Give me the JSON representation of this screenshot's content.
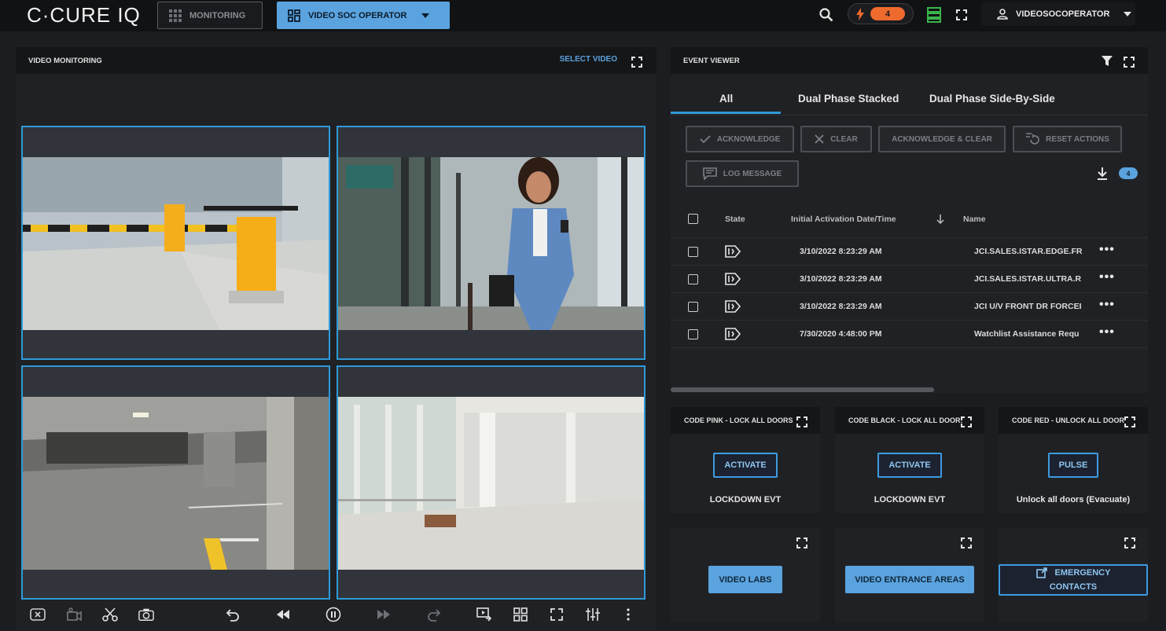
{
  "app": {
    "logo": "C·CURE IQ"
  },
  "topbar": {
    "monitoring_label": "MONITORING",
    "workspace_label": "VIDEO SOC OPERATOR",
    "alert_count": "4",
    "user_label": "VIDEOSOCOPERATOR",
    "accent": "#5aa3df",
    "alert_color": "#ef6a2d"
  },
  "video_monitoring": {
    "title": "VIDEO MONITORING",
    "select_video": "SELECT VIDEO",
    "tiles": [
      "parking-barrier-camera",
      "lobby-woman-camera",
      "parking-garage-camera",
      "atrium-camera"
    ],
    "toolbar_icons": [
      "clear-video-icon",
      "camera-off-icon",
      "scissors-icon",
      "snapshot-icon",
      "undo-icon",
      "rewind-icon",
      "pause-icon",
      "fast-forward-icon",
      "redo-icon",
      "export-icon",
      "grid-icon",
      "fullscreen-icon",
      "sliders-icon",
      "more-vertical-icon"
    ]
  },
  "event_viewer": {
    "title": "EVENT VIEWER",
    "tabs": [
      "All",
      "Dual Phase Stacked",
      "Dual Phase Side-By-Side"
    ],
    "buttons": {
      "acknowledge": "ACKNOWLEDGE",
      "clear": "CLEAR",
      "ack_clear": "ACKNOWLEDGE & CLEAR",
      "reset": "RESET ACTIONS",
      "log": "LOG MESSAGE"
    },
    "download_count": "4",
    "columns": {
      "state": "State",
      "date": "Initial Activation Date/Time",
      "name": "Name"
    },
    "rows": [
      {
        "date": "3/10/2022 8:23:29 AM",
        "name": "JCI.SALES.ISTAR.EDGE.FR"
      },
      {
        "date": "3/10/2022 8:23:29 AM",
        "name": "JCI.SALES.ISTAR.ULTRA.R"
      },
      {
        "date": "3/10/2022 8:23:29 AM",
        "name": "JCI U/V FRONT DR FORCEI"
      },
      {
        "date": "7/30/2020 4:48:00 PM",
        "name": "Watchlist Assistance Requ"
      }
    ]
  },
  "actions": [
    {
      "title": "CODE PINK - LOCK ALL DOORS",
      "button": "ACTIVATE",
      "desc": "LOCKDOWN EVT"
    },
    {
      "title": "CODE BLACK - LOCK ALL DOOR:",
      "button": "ACTIVATE",
      "desc": "LOCKDOWN EVT"
    },
    {
      "title": "CODE RED - UNLOCK ALL DOOR",
      "button": "PULSE",
      "desc": "Unlock all doors (Evacuate)"
    }
  ],
  "links": {
    "video_labs": "VIDEO LABS",
    "entrance": "VIDEO ENTRANCE AREAS",
    "emergency_line1": "EMERGENCY",
    "emergency_line2": "CONTACTS"
  }
}
